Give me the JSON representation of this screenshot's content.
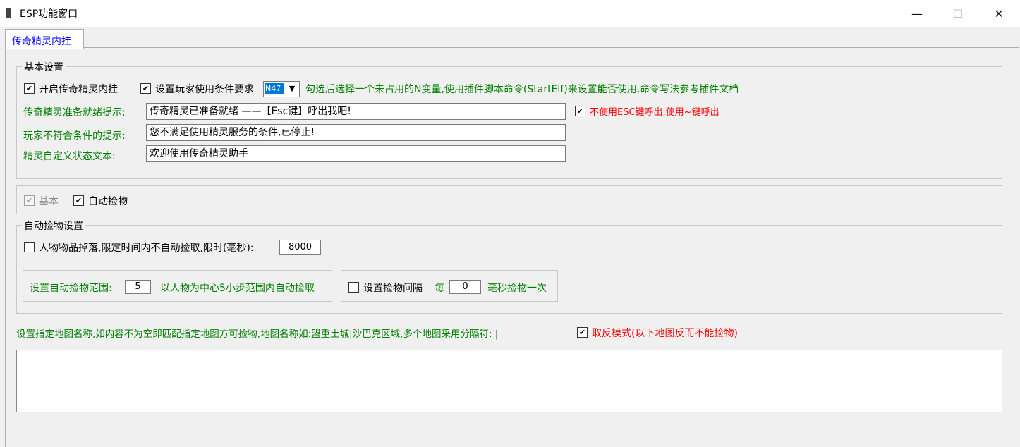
{
  "window": {
    "title": "ESP功能窗口"
  },
  "tab": {
    "label": "传奇精灵内挂"
  },
  "basic_settings": {
    "legend": "基本设置",
    "enable_label": "开启传奇精灵内挂",
    "player_condition_label": "设置玩家使用条件要求",
    "variable_select": "N47",
    "variable_hint": "勾选后选择一个未占用的N变量,使用插件脚本命令(StartElf)来设置能否使用,命令写法参考插件文档",
    "ready_label": "传奇精灵准备就绪提示:",
    "ready_value": "传奇精灵已准备就绪 ——【Esc键】呼出我吧!",
    "no_esc_label": "不使用ESC键呼出,使用~键呼出",
    "unqualified_label": "玩家不符合条件的提示:",
    "unqualified_value": "您不满足使用精灵服务的条件,已停止!",
    "status_label": "精灵自定义状态文本:",
    "status_value": "欢迎使用传奇精灵助手"
  },
  "feature_toggles": {
    "basic_label": "基本",
    "auto_pickup_label": "自动捡物"
  },
  "auto_pickup": {
    "legend": "自动捡物设置",
    "drop_delay_label": "人物物品掉落,限定时间内不自动捡取,限时(毫秒):",
    "drop_delay_value": "8000",
    "range_label": "设置自动捡物范围:",
    "range_value": "5",
    "range_hint": "以人物为中心5小步范围内自动捡取",
    "interval_label": "设置捡物间隔",
    "interval_prefix": "每",
    "interval_value": "0",
    "interval_suffix": "毫秒捡物一次"
  },
  "map_filter": {
    "hint": "设置指定地图名称,如内容不为空即匹配指定地图方可捡物,地图名称如:盟重土城|沙巴克区域,多个地图采用分隔符: |",
    "invert_label": "取反模式(以下地图反而不能捡物)",
    "text": ""
  }
}
